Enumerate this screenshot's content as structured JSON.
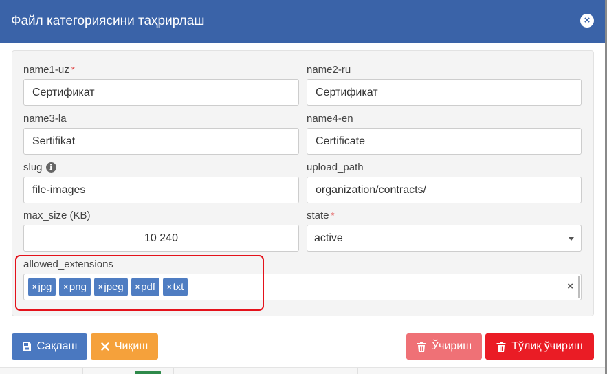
{
  "modal": {
    "title": "Файл категориясини таҳрирлаш"
  },
  "form": {
    "name1": {
      "label": "name1-uz",
      "required": "*",
      "value": "Сертификат"
    },
    "name2": {
      "label": "name2-ru",
      "value": "Сертификат"
    },
    "name3": {
      "label": "name3-la",
      "value": "Sertifikat"
    },
    "name4": {
      "label": "name4-en",
      "value": "Certificate"
    },
    "slug": {
      "label": "slug",
      "info_icon": "i",
      "value": "file-images"
    },
    "upload_path": {
      "label": "upload_path",
      "value": "organization/contracts/"
    },
    "max_size": {
      "label": "max_size (KB)",
      "value": "10 240"
    },
    "state": {
      "label": "state",
      "required": "*",
      "value": "active"
    },
    "allowed_extensions": {
      "label": "allowed_extensions",
      "tags": [
        "jpg",
        "png",
        "jpeg",
        "pdf",
        "txt"
      ],
      "tag_remove": "×",
      "clear_all": "×"
    }
  },
  "buttons": {
    "save": "Сақлаш",
    "exit": "Чиқиш",
    "delete": "Ўчириш",
    "delete_full": "Тўлиқ ўчириш"
  },
  "icons": {
    "close": "close-circle-icon",
    "save": "floppy-disk-icon",
    "exit": "times-icon",
    "delete": "trash-icon",
    "info": "info-circle-icon"
  },
  "colors": {
    "header": "#3a63a8",
    "tag": "#4f7dc2",
    "save": "#4a78c0",
    "exit": "#f5a13b",
    "delete": "#ef7176",
    "delete_full": "#ea1c25",
    "highlight": "#e4121b"
  }
}
